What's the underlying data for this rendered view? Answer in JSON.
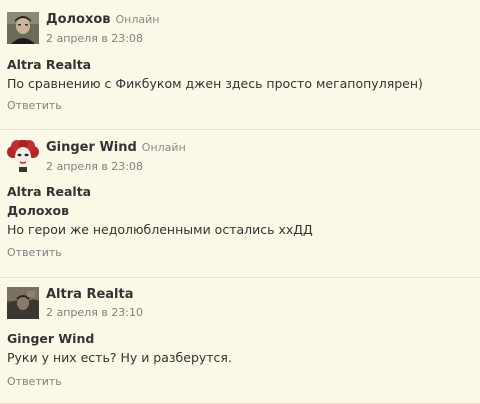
{
  "comments": [
    {
      "author": "Долохов",
      "status": "Онлайн",
      "date": "2 апреля в 23:08",
      "quote1": "Altra Realta",
      "quote2": "",
      "text": "По сравнению с Фикбуком джен здесь просто мегапопулярен)",
      "reply": "Ответить",
      "avatar_icon": "portrait-man-avatar"
    },
    {
      "author": "Ginger Wind",
      "status": "Онлайн",
      "date": "2 апреля в 23:08",
      "quote1": "Altra Realta",
      "quote2": "Долохов",
      "text": "Но герои же недолюбленными остались ххДД",
      "reply": "Ответить",
      "avatar_icon": "red-haired-face-avatar"
    },
    {
      "author": "Altra Realta",
      "status": "",
      "date": "2 апреля в 23:10",
      "quote1": "Ginger Wind",
      "quote2": "",
      "text": "Руки у них есть? Ну и разберутся.",
      "reply": "Ответить",
      "avatar_icon": "dark-fantasy-avatar"
    }
  ]
}
